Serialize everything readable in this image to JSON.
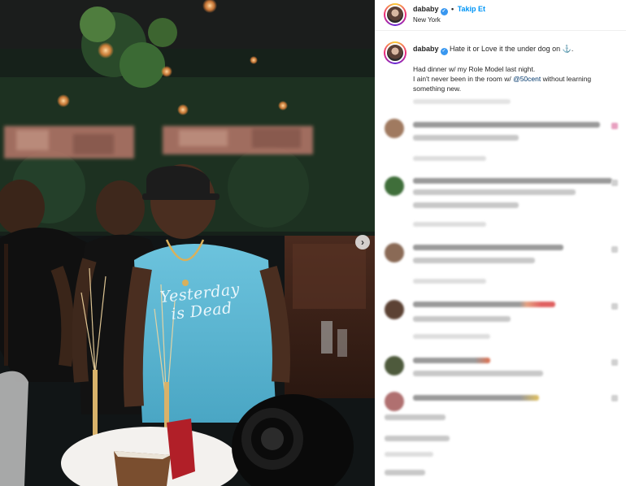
{
  "post": {
    "image_alt_text": "",
    "shirt_print": "Yesterday is Dead",
    "next_icon": "chevron-right-icon",
    "next_glyph": "›"
  },
  "header": {
    "username": "dababy",
    "verified_glyph": "✓",
    "separator": "•",
    "follow_label": "Takip Et",
    "location": "New York"
  },
  "caption": {
    "username": "dababy",
    "verified_glyph": "✓",
    "first_line": "Hate it or Love it the under dog on",
    "emoji": "⚓",
    "after_emoji": ".",
    "line2": "Had dinner w/ my Role Model last night.",
    "line3_prefix": "I ain't never been in the room w/",
    "mention": "@50cent",
    "line3_suffix": "without learning something new."
  },
  "colors": {
    "accent": "#0095f6",
    "verified": "#3897f0",
    "mention": "#00376b",
    "text": "#262626",
    "shirt": "#5eb8d4"
  }
}
